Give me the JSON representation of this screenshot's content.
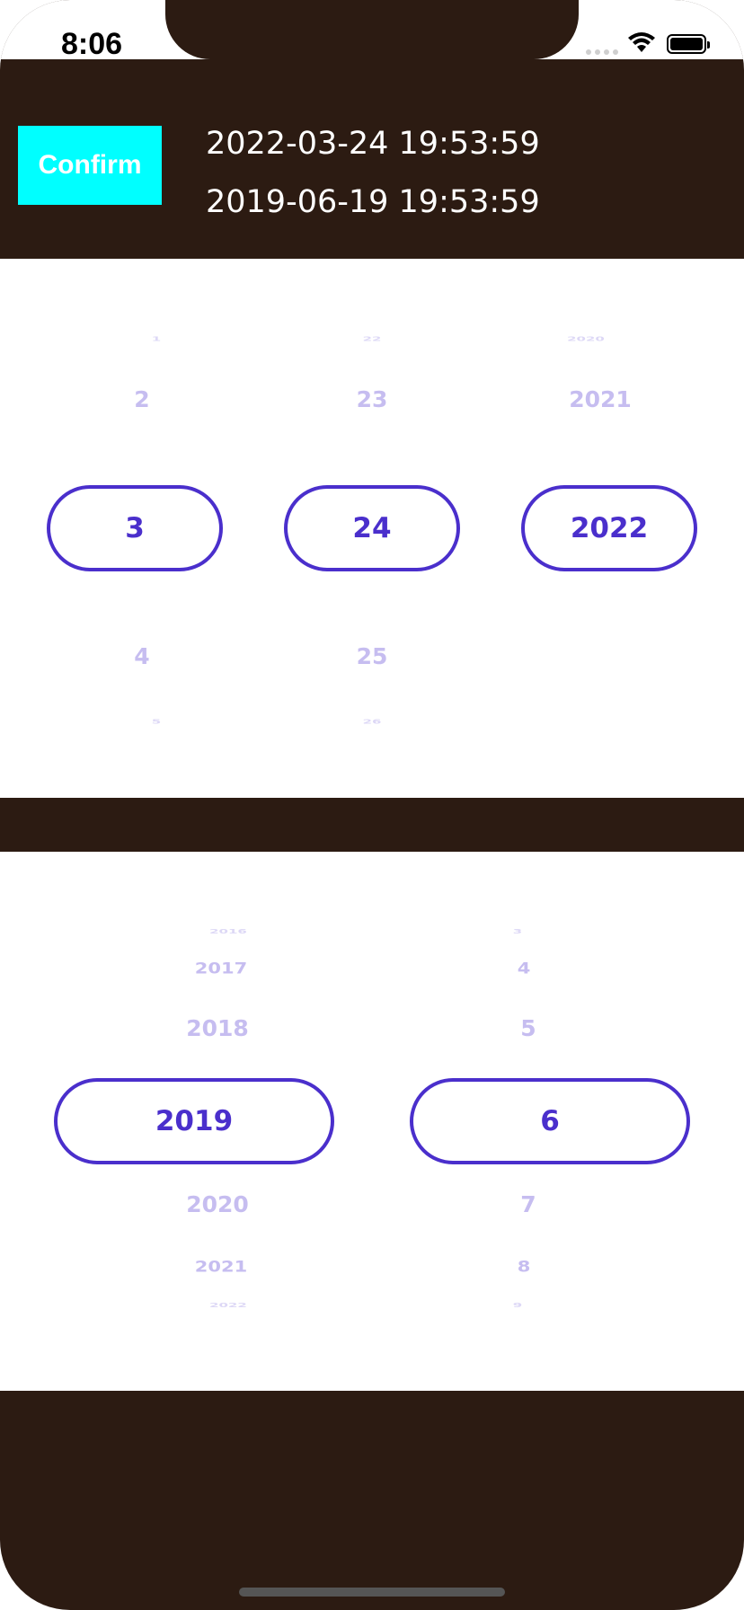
{
  "status_bar": {
    "time": "8:06"
  },
  "header": {
    "confirm_label": "Confirm",
    "date_primary": "2022-03-24 19:53:59",
    "date_secondary": "2019-06-19 19:53:59"
  },
  "picker_top": {
    "month": {
      "far_above": "1",
      "above": "2",
      "selected": "3",
      "below": "4",
      "far_below": "5"
    },
    "day": {
      "far_above": "22",
      "above": "23",
      "selected": "24",
      "below": "25",
      "far_below": "26"
    },
    "year": {
      "far_above": "2020",
      "above": "2021",
      "selected": "2022"
    }
  },
  "picker_bottom": {
    "year": {
      "far_above": "2016",
      "mid_above": "2017",
      "above": "2018",
      "selected": "2019",
      "below": "2020",
      "mid_below": "2021",
      "far_below": "2022"
    },
    "month": {
      "far_above": "3",
      "mid_above": "4",
      "above": "5",
      "selected": "6",
      "below": "7",
      "mid_below": "8",
      "far_below": "9"
    }
  },
  "colors": {
    "background": "#2c1b12",
    "confirm_button": "#00ffff",
    "accent": "#4a2fcc",
    "faded_item": "#c6bdf0"
  },
  "icons": {
    "wifi": "wifi-icon",
    "battery": "battery-icon",
    "signal": "signal-icon"
  }
}
